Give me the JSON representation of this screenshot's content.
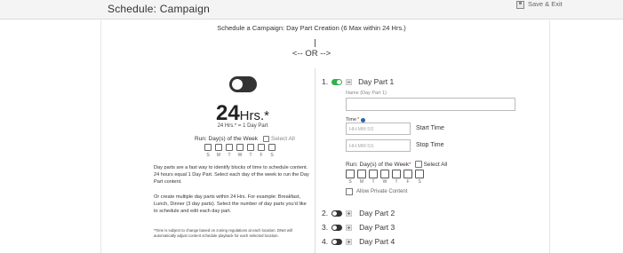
{
  "header": {
    "title": "Schedule: Campaign",
    "save_exit_label": "Save & Exit"
  },
  "main": {
    "subtitle": "Schedule a Campaign: Day Part Creation (6 Max within 24 Hrs.)",
    "or_label": "<--  OR  -->"
  },
  "left": {
    "toggle_on": false,
    "hrs_number": "24",
    "hrs_unit": "Hrs.*",
    "hrs_sub": "24 Hrs.* = 1 Day Part",
    "run_label": "Run: Day(s) of the Week",
    "select_all_label": "Select All",
    "days": [
      "S",
      "M",
      "T",
      "W",
      "T",
      "F",
      "S"
    ],
    "paragraph_1": "Day parts are a fast way to identify blocks of time to schedule content. 24 hours equal 1 Day Part. Select each day of the week to run the Day Part content.",
    "paragraph_2": "Or create multiple day parts within 24 Hrs. For example: Breakfast, Lunch, Dinner (3 day parts). Select the number of day parts you'd like to schedule and edit each day part.",
    "note": "*Time is subject to change based on zoning regulations at each location. DNet will automatically adjust content schedule playback for each selected location."
  },
  "right": {
    "day_part_1": {
      "number": "1.",
      "toggle_on": true,
      "label": "Day Part 1",
      "name_label": "Name (Day Part 1)",
      "name_value": "",
      "time_label": "Time",
      "time_required": "*",
      "start_placeholder": "HH:MM:SS",
      "stop_placeholder": "HH:MM:SS",
      "start_label": "Start Time",
      "stop_label": "Stop Time",
      "run_label": "Run: Day(s) of the Week",
      "run_required": "*",
      "select_all_label": "Select All",
      "days": [
        "S",
        "M",
        "T",
        "W",
        "T",
        "F",
        "S"
      ],
      "allow_private_label": "Allow Private Content"
    },
    "other_parts": [
      {
        "number": "2.",
        "label": "Day Part 2",
        "toggle_on": false
      },
      {
        "number": "3.",
        "label": "Day Part 3",
        "toggle_on": false
      },
      {
        "number": "4.",
        "label": "Day Part 4",
        "toggle_on": false
      }
    ]
  },
  "colors": {
    "toggle_on": "#2db34a",
    "toggle_off": "#333333",
    "required": "#c0392b",
    "info": "#2a62a8"
  }
}
